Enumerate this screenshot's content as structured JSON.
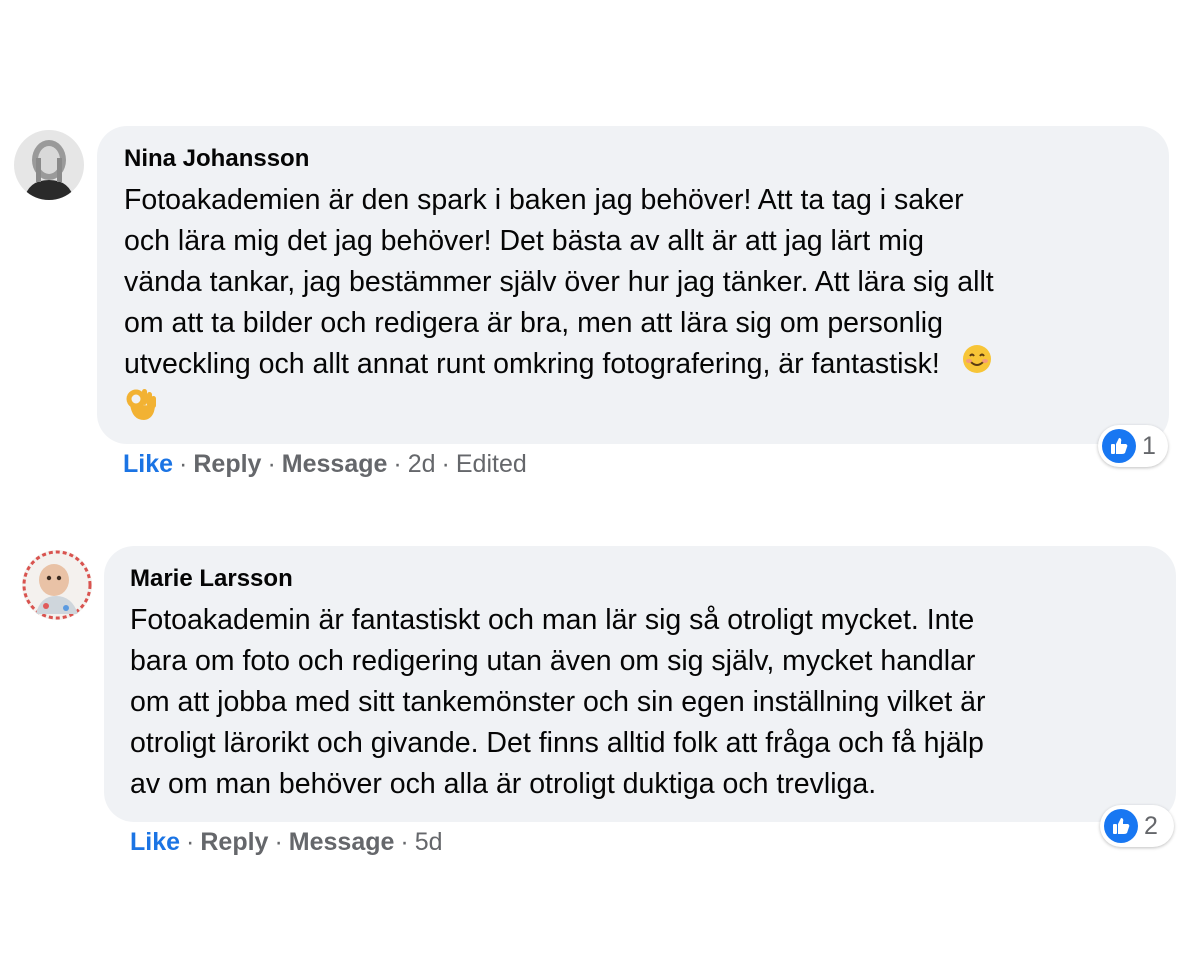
{
  "comments": [
    {
      "author": "Nina Johansson",
      "lines": [
        "Fotoakademien är den spark i baken jag behöver! Att ta tag i saker",
        "och lära mig det jag behöver! Det bästa av allt är att jag lärt mig",
        "vända tankar, jag bestämmer själv över hur jag tänker. Att lära sig allt",
        "om att ta bilder och redigera är bra, men att lära sig om personlig",
        "utveckling och allt annat runt omkring fotografering, är fantastisk!"
      ],
      "emojis": [
        "smiling-face-emoji",
        "ok-hand-emoji"
      ],
      "actions": {
        "like": "Like",
        "reply": "Reply",
        "message": "Message",
        "time": "2d",
        "edited": "Edited",
        "separator": "·"
      },
      "reaction_count": "1"
    },
    {
      "author": "Marie Larsson",
      "lines": [
        "Fotoakademin är fantastiskt och man lär sig så otroligt mycket. Inte",
        "bara om foto och redigering utan även om sig själv, mycket handlar",
        "om att jobba med sitt tankemönster och sin egen inställning vilket är",
        "otroligt lärorikt och givande. Det finns alltid folk att fråga och få hjälp",
        "av om man behöver och alla är otroligt duktiga och trevliga."
      ],
      "actions": {
        "like": "Like",
        "reply": "Reply",
        "message": "Message",
        "time": "5d",
        "separator": "·"
      },
      "reaction_count": "2"
    }
  ],
  "colors": {
    "bubble": "#f0f2f5",
    "like_blue": "#1b74e4",
    "reaction_blue": "#1877f2",
    "meta_gray": "#65676b",
    "text": "#050505"
  }
}
